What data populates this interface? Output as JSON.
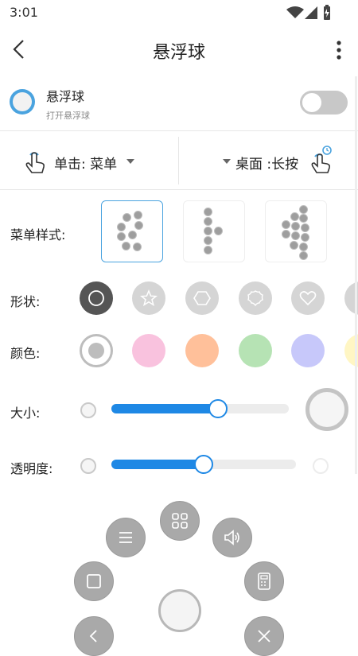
{
  "status_bar": {
    "time": "3:01"
  },
  "app_bar": {
    "title": "悬浮球"
  },
  "floating_ball": {
    "title": "悬浮球",
    "subtitle": "打开悬浮球",
    "enabled": false
  },
  "gestures": {
    "left": {
      "label": "单击: 菜单"
    },
    "right": {
      "label": "桌面 :长按"
    }
  },
  "menu_style": {
    "label": "菜单样式:",
    "selected_index": 0
  },
  "shape": {
    "label": "形状:",
    "selected_index": 0,
    "icons": [
      "circle-icon",
      "star-icon",
      "hexagon-icon",
      "flower-icon",
      "heart-icon"
    ]
  },
  "color": {
    "label": "颜色:",
    "selected_index": 0,
    "swatches": [
      "#bdbdbd",
      "#f9c2de",
      "#ffc09a",
      "#b6e3b4",
      "#c7c8fa"
    ]
  },
  "size": {
    "label": "大小:",
    "value_fraction": 0.6
  },
  "opacity": {
    "label": "透明度:",
    "value_fraction": 0.5
  },
  "preview_menu": {
    "icons": [
      "list-icon",
      "grid-icon",
      "volume-icon",
      "square-icon",
      "calculator-icon",
      "back-icon",
      "tools-icon"
    ]
  },
  "colors": {
    "accent": "#1e88e5",
    "selected_border": "#4aa3df"
  }
}
